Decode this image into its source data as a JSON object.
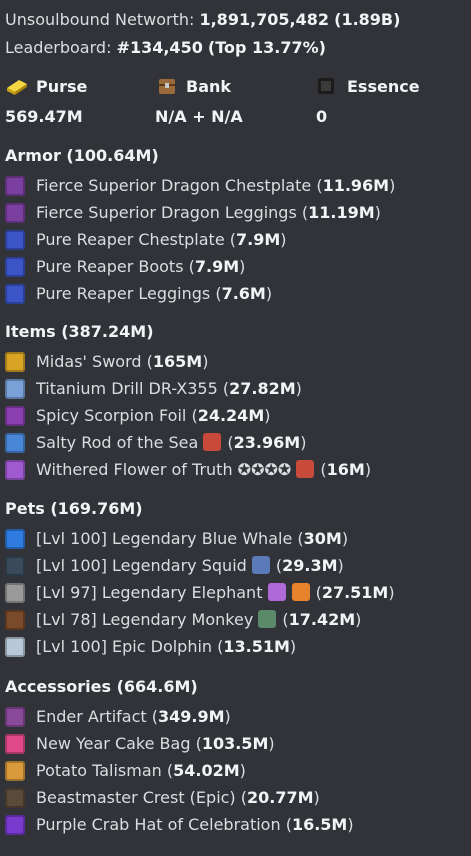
{
  "summary": {
    "networth_label": "Unsoulbound Networth:",
    "networth_value": "1,891,705,482",
    "networth_short": "(1.89B)",
    "leaderboard_label": "Leaderboard:",
    "leaderboard_rank": "#134,450",
    "leaderboard_top": "(Top 13.77%)"
  },
  "stats": [
    {
      "label": "Purse",
      "value": "569.47M",
      "icon": "gold-ingot-icon"
    },
    {
      "label": "Bank",
      "value": "N/A + N/A",
      "icon": "chest-icon"
    },
    {
      "label": "Essence",
      "value": "0",
      "icon": "wither-essence-icon"
    }
  ],
  "sections": {
    "armor": {
      "title": "Armor (100.64M)",
      "items": [
        {
          "name": "Fierce Superior Dragon Chestplate ",
          "value": "11.96M",
          "icon": "dragon-chestplate-icon",
          "color": "#7b3fa0"
        },
        {
          "name": "Fierce Superior Dragon Leggings ",
          "value": "11.19M",
          "icon": "dragon-leggings-icon",
          "color": "#7b3fa0"
        },
        {
          "name": "Pure Reaper Chestplate ",
          "value": "7.9M",
          "icon": "reaper-chestplate-icon",
          "color": "#3b55c8"
        },
        {
          "name": "Pure Reaper Boots ",
          "value": "7.9M",
          "icon": "reaper-boots-icon",
          "color": "#3b55c8"
        },
        {
          "name": "Pure Reaper Leggings ",
          "value": "7.6M",
          "icon": "reaper-leggings-icon",
          "color": "#3b55c8"
        }
      ]
    },
    "items": {
      "title": "Items (387.24M)",
      "items": [
        {
          "name": "Midas' Sword ",
          "value": "165M",
          "icon": "golden-sword-icon",
          "color": "#d9a425"
        },
        {
          "name": "Titanium Drill DR-X355 ",
          "value": "27.82M",
          "icon": "drill-icon",
          "color": "#7aa0d8"
        },
        {
          "name": "Spicy Scorpion Foil ",
          "value": "24.24M",
          "icon": "scorpion-foil-icon",
          "color": "#8a3fb0"
        },
        {
          "name": "Salty Rod of the Sea ",
          "value": "23.96M",
          "icon": "fishing-rod-icon",
          "color": "#4a86d8",
          "extra": "enchanted-book-icon"
        },
        {
          "name": "Withered Flower of Truth ✪✪✪✪ ",
          "value": "16M",
          "icon": "flower-of-truth-icon",
          "color": "#a05ad0",
          "extra": "wither-shield-icon"
        }
      ]
    },
    "pets": {
      "title": "Pets (169.76M)",
      "items": [
        {
          "name": "[Lvl 100] Legendary Blue Whale ",
          "value": "30M",
          "icon": "blue-whale-icon",
          "color": "#2f7be0"
        },
        {
          "name": "[Lvl 100] Legendary Squid ",
          "value": "29.3M",
          "icon": "squid-icon",
          "color": "#3a4a5a",
          "extra": "squid-item-icon"
        },
        {
          "name": "[Lvl 97] Legendary Elephant ",
          "value": "27.51M",
          "icon": "elephant-icon",
          "color": "#9a9a9a",
          "extra": "pet-item-icon",
          "extra2": "carrot-icon"
        },
        {
          "name": "[Lvl 78] Legendary Monkey ",
          "value": "17.42M",
          "icon": "monkey-icon",
          "color": "#7a4a2a",
          "extra": "monkey-item-icon"
        },
        {
          "name": "[Lvl 100] Epic Dolphin ",
          "value": "13.51M",
          "icon": "dolphin-icon",
          "color": "#b8c8d8"
        }
      ]
    },
    "accessories": {
      "title": "Accessories (664.6M)",
      "items": [
        {
          "name": "Ender Artifact ",
          "value": "349.9M",
          "icon": "ender-artifact-icon",
          "color": "#8a4a9a"
        },
        {
          "name": "New Year Cake Bag ",
          "value": "103.5M",
          "icon": "cake-bag-icon",
          "color": "#e04a8a"
        },
        {
          "name": "Potato Talisman ",
          "value": "54.02M",
          "icon": "potato-talisman-icon",
          "color": "#d89a3a"
        },
        {
          "name": "Beastmaster Crest (Epic) ",
          "value": "20.77M",
          "icon": "beastmaster-crest-icon",
          "color": "#5a4a3a"
        },
        {
          "name": "Purple Crab Hat of Celebration ",
          "value": "16.5M",
          "icon": "crab-hat-icon",
          "color": "#7a3ad0"
        }
      ]
    }
  },
  "colors": {
    "background": "#313338",
    "text": "#dbdee1",
    "bold": "#f2f3f5"
  }
}
